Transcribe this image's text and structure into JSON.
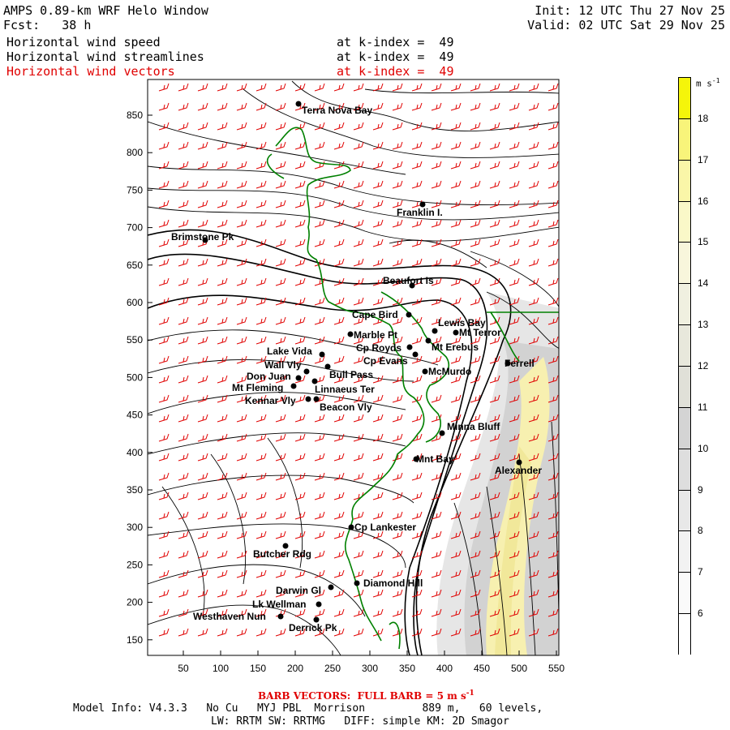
{
  "header": {
    "title": "AMPS 0.89-km WRF Helo Window",
    "fcst": "Fcst:   38 h",
    "init": "Init: 12 UTC Thu 27 Nov 25",
    "valid": "Valid: 02 UTC Sat 29 Nov 25",
    "layers": [
      {
        "name": "Horizontal wind speed",
        "kindex": "at k-index =  49",
        "color": "#000000"
      },
      {
        "name": "Horizontal wind streamlines",
        "kindex": "at k-index =  49",
        "color": "#000000"
      },
      {
        "name": "Horizontal wind vectors",
        "kindex": "at k-index =  49",
        "color": "#e00000"
      }
    ]
  },
  "map": {
    "x_ticks": [
      "50",
      "100",
      "150",
      "200",
      "250",
      "300",
      "350",
      "400",
      "450",
      "500",
      "550"
    ],
    "y_ticks": [
      "850",
      "800",
      "750",
      "700",
      "650",
      "600",
      "550",
      "500",
      "450",
      "400",
      "350",
      "300",
      "250",
      "200",
      "150"
    ],
    "sites": [
      {
        "name": "Terra Nova Bay"
      },
      {
        "name": "Franklin I."
      },
      {
        "name": "Brimstone Pk"
      },
      {
        "name": "Beaufort Is"
      },
      {
        "name": "Cape Bird"
      },
      {
        "name": "Lewis Bay"
      },
      {
        "name": "Mt Terror"
      },
      {
        "name": "Marble Pt"
      },
      {
        "name": "Cp Royds"
      },
      {
        "name": "Mt Erebus"
      },
      {
        "name": "Cp Evans"
      },
      {
        "name": "Lake Vida"
      },
      {
        "name": "Wall Vly"
      },
      {
        "name": "Don Juan"
      },
      {
        "name": "Bull Pass"
      },
      {
        "name": "Mt Fleming"
      },
      {
        "name": "Linnaeus Ter"
      },
      {
        "name": "McMurdo"
      },
      {
        "name": "Ferrell"
      },
      {
        "name": "Kennar Vly"
      },
      {
        "name": "Beacon Vly"
      },
      {
        "name": "Minna Bluff"
      },
      {
        "name": "Mnt Bay"
      },
      {
        "name": "Alexander"
      },
      {
        "name": "Cp Lankester"
      },
      {
        "name": "Butcher Rdg"
      },
      {
        "name": "Darwin Gl"
      },
      {
        "name": "Diamond Hill"
      },
      {
        "name": "Lk Wellman"
      },
      {
        "name": "Westhaven Nun"
      },
      {
        "name": "Derrick Pk"
      }
    ],
    "coast_color": "#008000",
    "barb_color": "#e00000"
  },
  "colorbar": {
    "unit": "m s",
    "unit_sup": "-1",
    "labels": [
      "18",
      "17",
      "16",
      "15",
      "14",
      "13",
      "12",
      "11",
      "10",
      "9",
      "8",
      "7",
      "6"
    ]
  },
  "footer": {
    "barb_note": "BARB VECTORS:  FULL BARB = 5 m s",
    "barb_sup": "-1",
    "model_line1": "Model Info: V4.3.3   No Cu   MYJ PBL  Morrison         889 m,   60 levels,",
    "model_line2": "LW: RRTM SW: RRTMG   DIFF: simple KM: 2D Smagor"
  }
}
